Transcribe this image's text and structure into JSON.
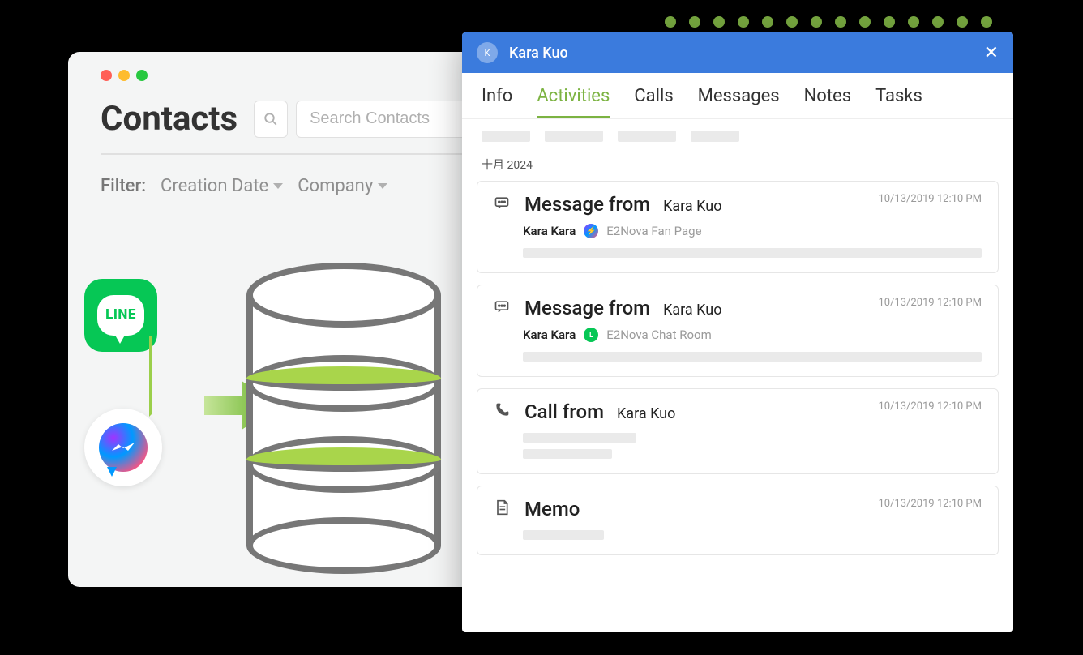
{
  "contacts": {
    "title": "Contacts",
    "search_placeholder": "Search Contacts",
    "filter_label": "Filter:",
    "filters": [
      {
        "label": "Creation Date"
      },
      {
        "label": "Company"
      }
    ]
  },
  "illustration": {
    "line_label": "LINE"
  },
  "modal": {
    "person_name": "Kara Kuo",
    "tabs": [
      {
        "label": "Info",
        "active": false
      },
      {
        "label": "Activities",
        "active": true
      },
      {
        "label": "Calls",
        "active": false
      },
      {
        "label": "Messages",
        "active": false
      },
      {
        "label": "Notes",
        "active": false
      },
      {
        "label": "Tasks",
        "active": false
      }
    ],
    "month_label": "十月 2024",
    "activities": [
      {
        "type": "message",
        "title": "Message from",
        "who": "Kara Kuo",
        "timestamp": "10/13/2019 12:10 PM",
        "sender": "Kara Kara",
        "channel": "fb",
        "page": "E2Nova  Fan Page"
      },
      {
        "type": "message",
        "title": "Message from",
        "who": "Kara Kuo",
        "timestamp": "10/13/2019 12:10 PM",
        "sender": "Kara Kara",
        "channel": "line",
        "page": "E2Nova  Chat Room"
      },
      {
        "type": "call",
        "title": "Call from",
        "who": "Kara Kuo",
        "timestamp": "10/13/2019 12:10 PM"
      },
      {
        "type": "memo",
        "title": "Memo",
        "who": "",
        "timestamp": "10/13/2019 12:10 PM"
      }
    ]
  }
}
